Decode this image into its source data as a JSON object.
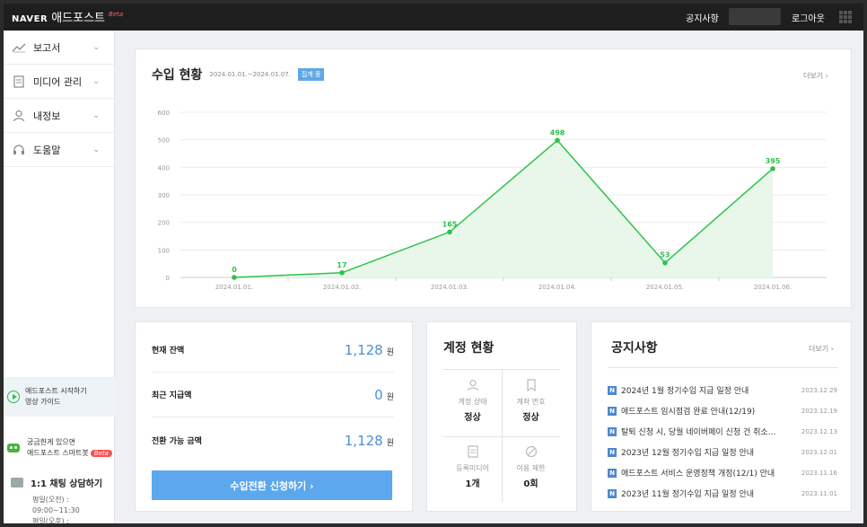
{
  "header": {
    "logo_naver": "NAVER",
    "logo_brand": "애드포스트",
    "logo_beta": "Beta",
    "notice_link": "공지사항",
    "logout": "로그아웃"
  },
  "sidebar": {
    "items": [
      {
        "label": "보고서",
        "icon": "line-chart-icon"
      },
      {
        "label": "미디어 관리",
        "icon": "document-icon"
      },
      {
        "label": "내정보",
        "icon": "person-icon"
      },
      {
        "label": "도움말",
        "icon": "headset-icon"
      }
    ],
    "guide_line1": "애드포스트 시작하기",
    "guide_line2": "영상 가이드",
    "bot_line1": "궁금한게 있으면",
    "bot_line2": "애드포스트 스마트봇",
    "bot_beta": "Beta",
    "chat_title": "1:1 채팅 상담하기",
    "chat_line1": "평일(오전) :",
    "chat_line2": "09:00~11:30",
    "chat_line3": "평일(오후) :"
  },
  "income": {
    "title": "수입 현황",
    "period": "2024.01.01.~2024.01.07.",
    "status": "집계 중",
    "more": "더보기"
  },
  "chart_data": {
    "type": "area",
    "categories": [
      "2024.01.01.",
      "2024.01.02.",
      "2024.01.03.",
      "2024.01.04.",
      "2024.01.05.",
      "2024.01.06."
    ],
    "values": [
      0,
      17,
      165,
      498,
      53,
      395
    ],
    "yticks": [
      0,
      100,
      200,
      300,
      400,
      500,
      600
    ],
    "ylim": [
      0,
      600
    ],
    "grid": true,
    "color": "#2ec24a",
    "fill": "#e8f7ea"
  },
  "balance": {
    "rows": [
      {
        "label": "현재 잔액",
        "value": "1,128",
        "unit": "원"
      },
      {
        "label": "최근 지급액",
        "value": "0",
        "unit": "원"
      },
      {
        "label": "전환 가능 금액",
        "value": "1,128",
        "unit": "원"
      }
    ],
    "cta": "수입전환 신청하기 ›"
  },
  "account": {
    "title": "계정 현황",
    "cells": [
      {
        "label": "계정 상태",
        "value": "정상",
        "icon": "person-icon"
      },
      {
        "label": "계좌 번호",
        "value": "정상",
        "icon": "bookmark-icon"
      },
      {
        "label": "등록미디어",
        "value": "1개",
        "icon": "document-icon"
      },
      {
        "label": "이용 제한",
        "value": "0회",
        "icon": "prohibit-icon"
      }
    ]
  },
  "notices": {
    "title": "공지사항",
    "more": "더보기",
    "items": [
      {
        "title": "2024년 1월 정기수입 지급 일정 안내",
        "date": "2023.12.29"
      },
      {
        "title": "애드포스트 임시점검 완료 안내(12/19)",
        "date": "2023.12.19"
      },
      {
        "title": "탈퇴 신청 시, 당월 네이버페이 신청 건 취소…",
        "date": "2023.12.13"
      },
      {
        "title": "2023년 12월 정기수입 지급 일정 안내",
        "date": "2023.12.01"
      },
      {
        "title": "애드포스트 서비스 운영정책 개정(12/1) 안내",
        "date": "2023.11.16"
      },
      {
        "title": "2023년 11월 정기수입 지급 일정 안내",
        "date": "2023.11.01"
      }
    ]
  }
}
